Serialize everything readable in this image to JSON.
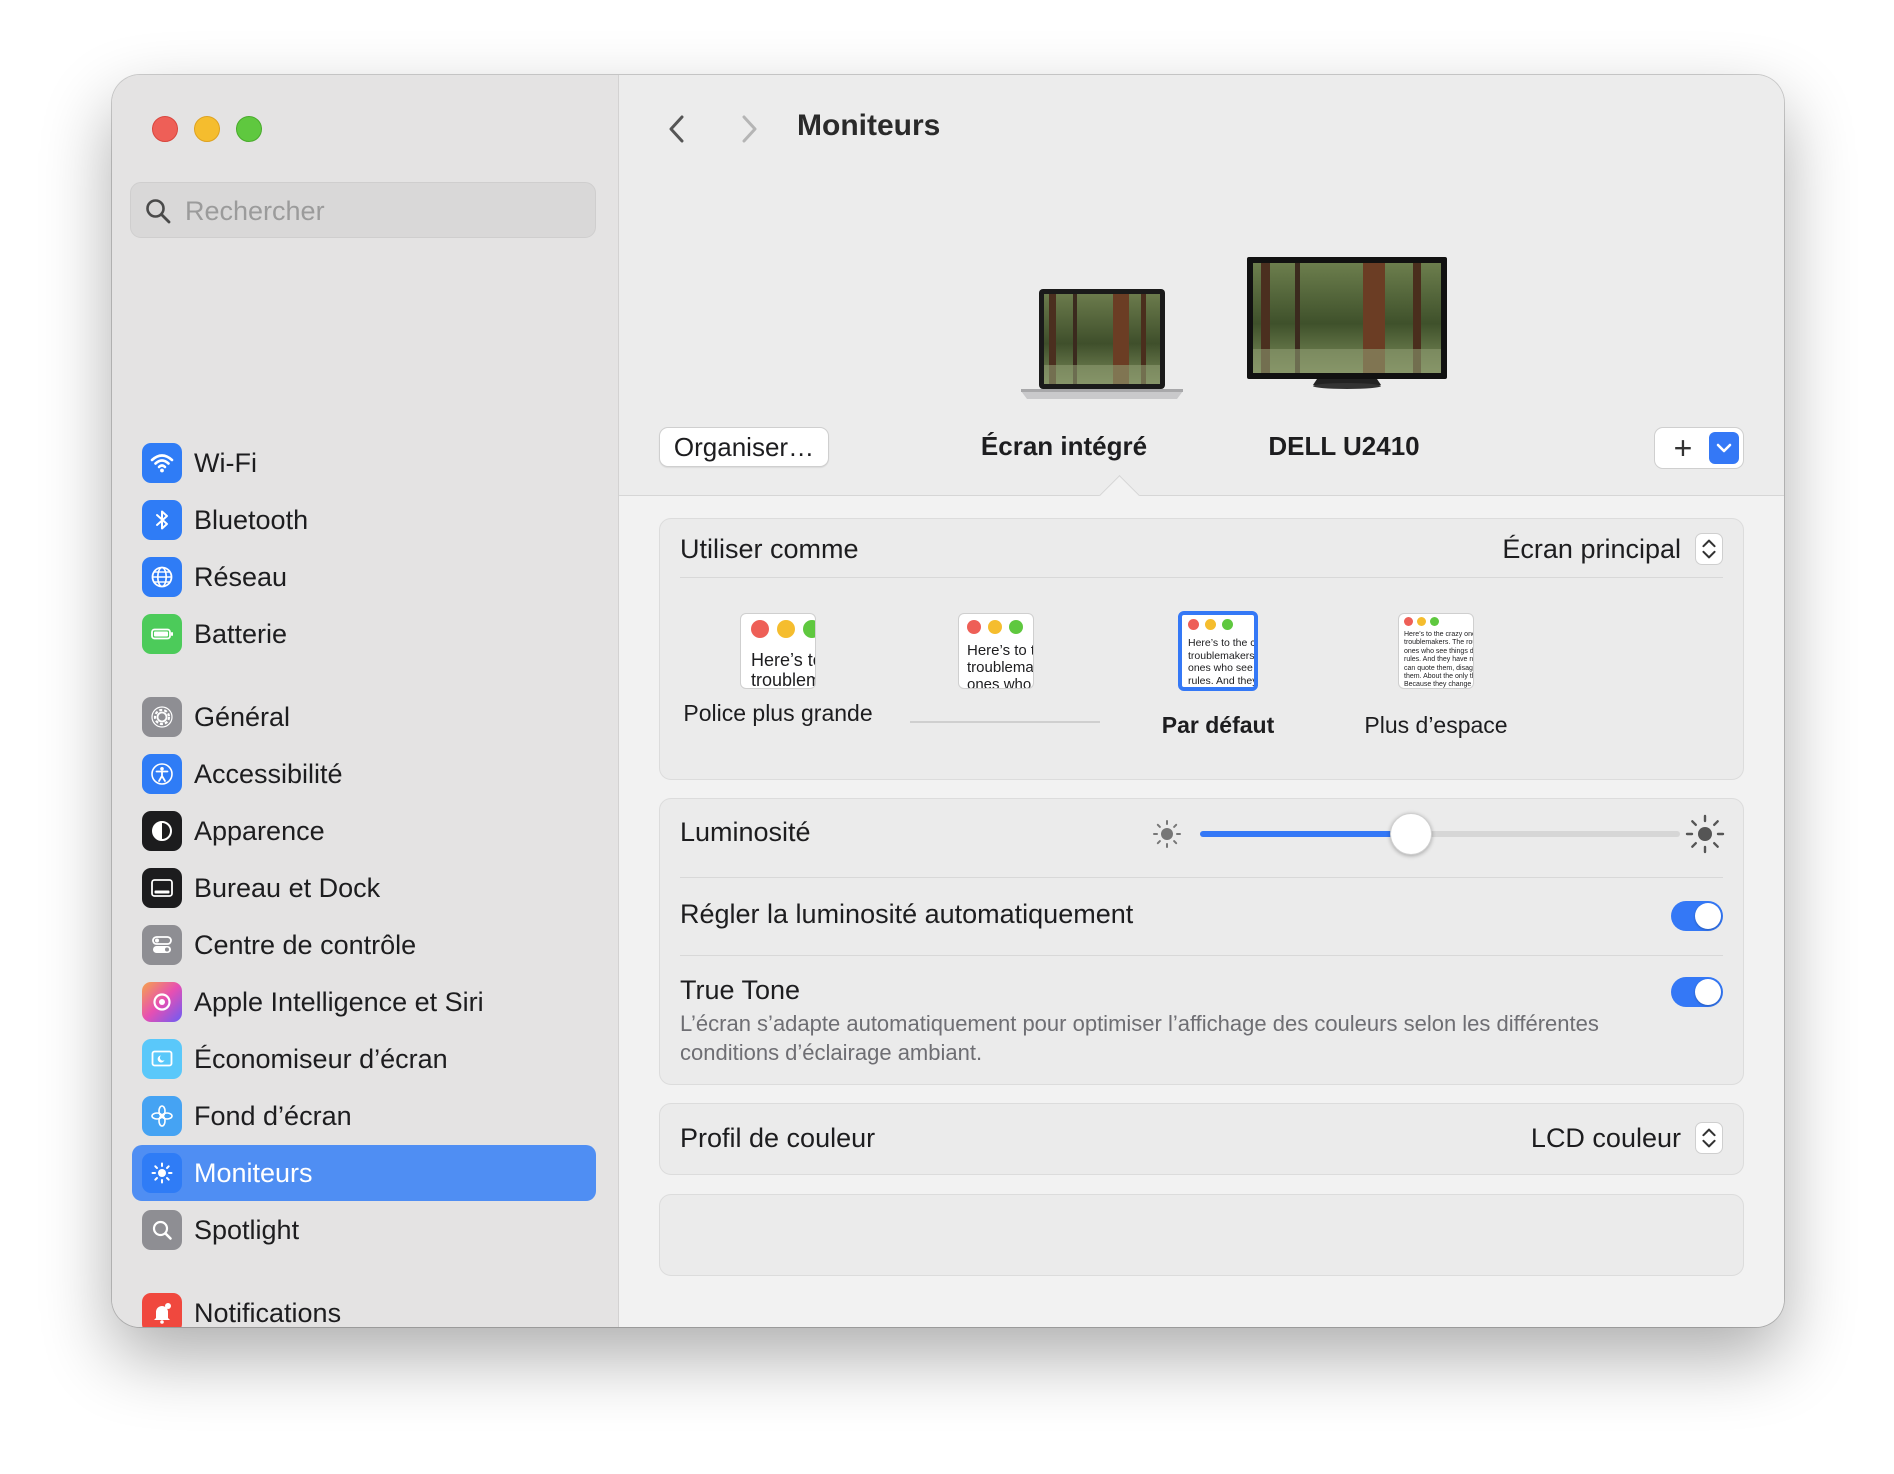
{
  "sidebar": {
    "search_placeholder": "Rechercher",
    "items": [
      {
        "label": "Wi-Fi",
        "icon": "wifi-icon",
        "color": "#2f7cf6"
      },
      {
        "label": "Bluetooth",
        "icon": "bluetooth-icon",
        "color": "#2f7cf6"
      },
      {
        "label": "Réseau",
        "icon": "globe-icon",
        "color": "#2f7cf6"
      },
      {
        "label": "Batterie",
        "icon": "battery-icon",
        "color": "#4ccb5a"
      },
      {
        "label": "Général",
        "icon": "gear-icon",
        "color": "#8e8e93"
      },
      {
        "label": "Accessibilité",
        "icon": "accessibility-icon",
        "color": "#2f7cf6"
      },
      {
        "label": "Apparence",
        "icon": "appearance-icon",
        "color": "#1c1c1e"
      },
      {
        "label": "Bureau et Dock",
        "icon": "dock-icon",
        "color": "#1c1c1e"
      },
      {
        "label": "Centre de contrôle",
        "icon": "control-center-icon",
        "color": "#8e8e93"
      },
      {
        "label": "Apple Intelligence et Siri",
        "icon": "siri-icon",
        "color": "#e06ad8"
      },
      {
        "label": "Économiseur d’écran",
        "icon": "screensaver-icon",
        "color": "#5ac8fa"
      },
      {
        "label": "Fond d’écran",
        "icon": "wallpaper-icon",
        "color": "#45a3f3"
      },
      {
        "label": "Moniteurs",
        "icon": "brightness-icon",
        "color": "#2f7cf6",
        "selected": true
      },
      {
        "label": "Spotlight",
        "icon": "spotlight-icon",
        "color": "#8e8e93"
      },
      {
        "label": "Notifications",
        "icon": "notifications-icon",
        "color": "#f0483e"
      }
    ]
  },
  "header": {
    "title": "Moniteurs",
    "organise_label": "Organiser…",
    "displays": [
      {
        "name": "Écran intégré",
        "selected": true
      },
      {
        "name": "DELL U2410",
        "selected": false
      }
    ],
    "add_label": "+"
  },
  "use_as": {
    "label": "Utiliser comme",
    "value": "Écran principal"
  },
  "resolution": {
    "options": [
      {
        "label": "Police plus grande",
        "preview": "Here’s to\ntroublem"
      },
      {
        "label": "",
        "preview": "Here’s to t\ntroublema\nones who"
      },
      {
        "label": "Par défaut",
        "preview": "Here’s to the cr\ntroublemakers.\nones who see t\nrules. And they",
        "selected": true
      },
      {
        "label": "Plus d’espace",
        "preview": "Here’s to the crazy ones\ntroublemakers. The rou\nones who see things di\nrules. And they have no\ncan quote them, disagr\nthem. About the only th\nBecause they change t"
      }
    ]
  },
  "brightness": {
    "label": "Luminosité",
    "value": 0.44
  },
  "auto_brightness": {
    "label": "Régler la luminosité automatiquement",
    "on": true
  },
  "true_tone": {
    "label": "True Tone",
    "description": "L’écran s’adapte automatiquement pour optimiser l’affichage des couleurs selon les différentes conditions d’éclairage ambiant.",
    "on": true
  },
  "color_profile": {
    "label": "Profil de couleur",
    "value": "LCD couleur"
  },
  "colors": {
    "accent": "#3478f6",
    "selected_sidebar": "#4f8ef3"
  }
}
